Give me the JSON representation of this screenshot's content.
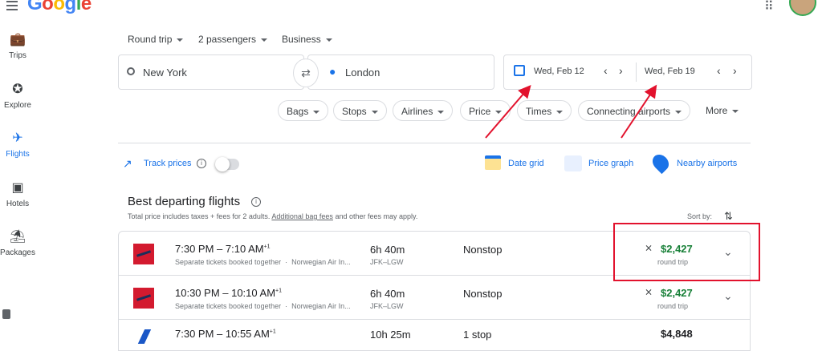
{
  "header": {
    "logo_letters": [
      {
        "char": "G",
        "color": "#4285f4"
      },
      {
        "char": "o",
        "color": "#ea4335"
      },
      {
        "char": "o",
        "color": "#fbbc05"
      },
      {
        "char": "g",
        "color": "#4285f4"
      },
      {
        "char": "l",
        "color": "#34a853"
      },
      {
        "char": "e",
        "color": "#ea4335"
      }
    ]
  },
  "sidebar": {
    "items": [
      {
        "label": "Trips",
        "icon": "suitcase-icon"
      },
      {
        "label": "Explore",
        "icon": "compass-icon"
      },
      {
        "label": "Flights",
        "icon": "airplane-icon",
        "active": true
      },
      {
        "label": "Hotels",
        "icon": "bed-icon"
      },
      {
        "label": "Packages",
        "icon": "beach-umbrella-icon"
      }
    ]
  },
  "search": {
    "trip_type": "Round trip",
    "passengers": "2 passengers",
    "cabin": "Business",
    "origin": "New York",
    "destination": "London",
    "depart_date": "Wed, Feb 12",
    "return_date": "Wed, Feb 19"
  },
  "filters": {
    "chips": [
      "Bags",
      "Stops",
      "Airlines",
      "Price",
      "Times",
      "Connecting airports"
    ],
    "more": "More"
  },
  "tools": {
    "track_prices": "Track prices",
    "date_grid": "Date grid",
    "price_graph": "Price graph",
    "nearby_airports": "Nearby airports"
  },
  "results": {
    "title": "Best departing flights",
    "subtitle_pre": "Total price includes taxes + fees for 2 adults.",
    "subtitle_link": "Additional bag fees",
    "subtitle_post": "and other fees may apply.",
    "sort_by": "Sort by:",
    "flights": [
      {
        "time": "7:30 PM – 7:10 AM",
        "plus": "+1",
        "sep": "Separate tickets booked together",
        "airline": "Norwegian Air In...",
        "duration": "6h 40m",
        "route": "JFK–LGW",
        "stops": "Nonstop",
        "price": "$2,427",
        "price_note": "round trip"
      },
      {
        "time": "10:30 PM – 10:10 AM",
        "plus": "+1",
        "sep": "Separate tickets booked together",
        "airline": "Norwegian Air In...",
        "duration": "6h 40m",
        "route": "JFK–LGW",
        "stops": "Nonstop",
        "price": "$2,427",
        "price_note": "round trip"
      },
      {
        "time": "7:30 PM – 10:55 AM",
        "plus": "+1",
        "duration": "10h 25m",
        "stops": "1 stop",
        "price": "$4,848"
      }
    ]
  },
  "colors": {
    "accent": "#1a73e8",
    "price_green": "#188038",
    "annotation_red": "#e2122d"
  }
}
